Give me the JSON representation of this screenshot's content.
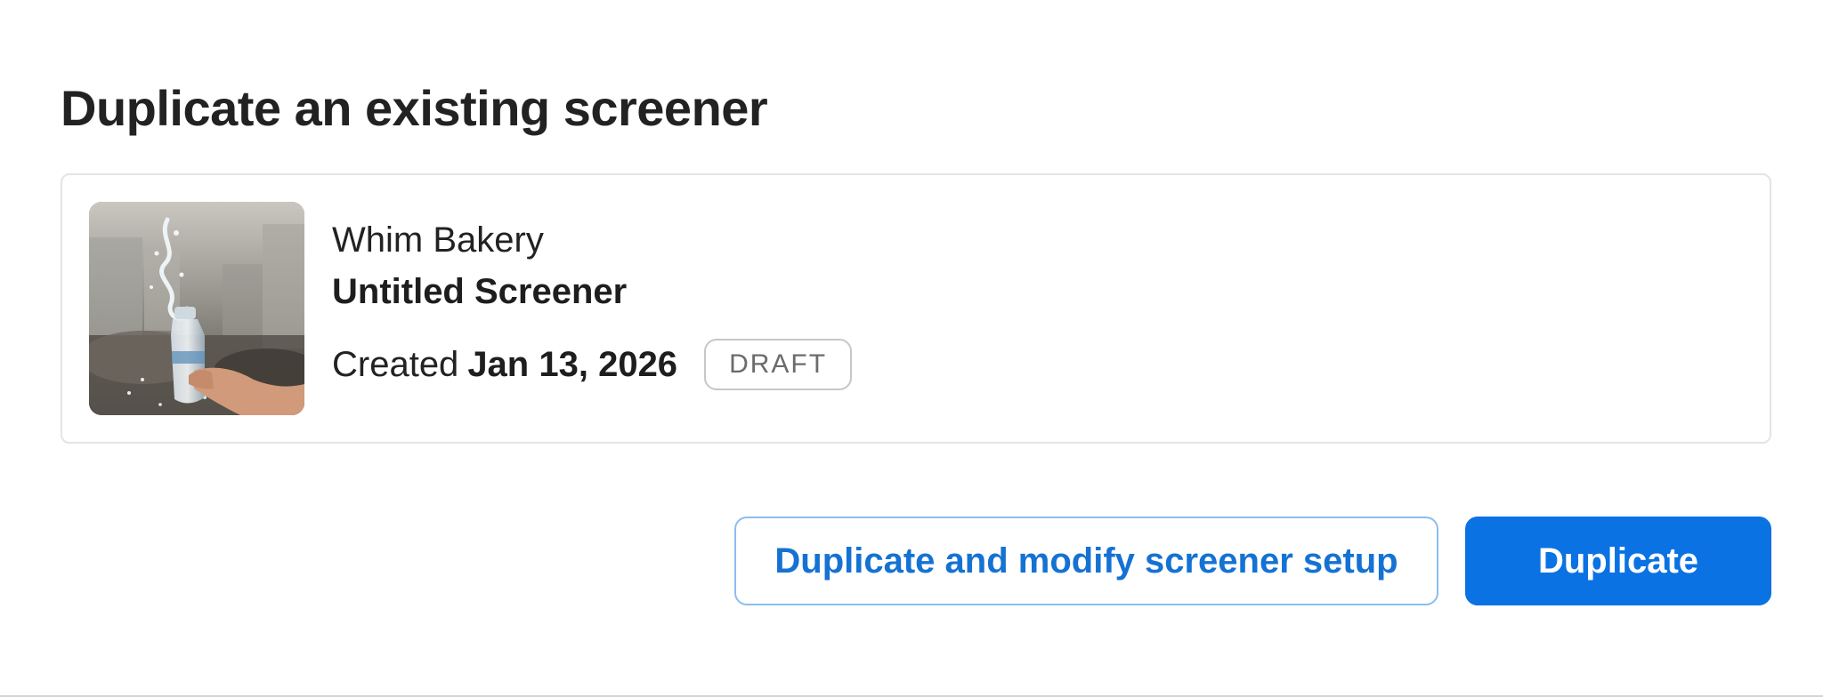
{
  "dialog": {
    "title": "Duplicate an existing screener"
  },
  "screener_card": {
    "organization": "Whim Bakery",
    "name": "Untitled Screener",
    "created_label": "Created",
    "created_date": "Jan 13, 2026",
    "status_badge": "DRAFT",
    "thumbnail_icon": "water-bottle-splash-photo"
  },
  "actions": {
    "duplicate_modify_label": "Duplicate and modify screener setup",
    "duplicate_label": "Duplicate"
  },
  "colors": {
    "primary": "#0a72e3",
    "secondary_border": "#8cbdf0",
    "secondary_text": "#1572d3",
    "badge_text": "#6b6b6b"
  }
}
